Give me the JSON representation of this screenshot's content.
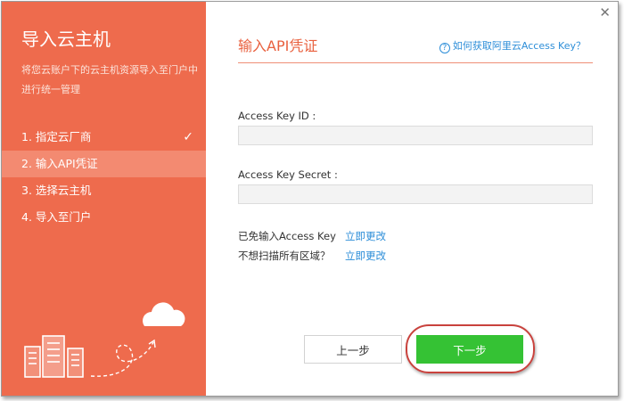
{
  "sidebar": {
    "title": "导入云主机",
    "description": "将您云账户下的云主机资源导入至门户中进行统一管理",
    "steps": [
      {
        "label": "1. 指定云厂商",
        "done": true
      },
      {
        "label": "2. 输入API凭证",
        "active": true
      },
      {
        "label": "3. 选择云主机"
      },
      {
        "label": "4. 导入至门户"
      }
    ]
  },
  "content": {
    "title": "输入API凭证",
    "help_icon": "?",
    "help_link": "如何获取阿里云Access Key？",
    "access_key_id_label": "Access Key ID :",
    "access_key_id_value": "",
    "access_key_secret_label": "Access Key Secret :",
    "access_key_secret_value": "",
    "option1_label": "已免输入Access Key",
    "option1_link": "立即更改",
    "option2_label": "不想扫描所有区域？",
    "option2_link": "立即更改",
    "prev_button": "上一步",
    "next_button": "下一步",
    "close_icon": "✕"
  },
  "colors": {
    "sidebar_bg": "#ee6b4d",
    "active_step_bg": "#f38a71",
    "accent": "#e9613f",
    "link": "#2d8ed8",
    "primary_button": "#35c234",
    "highlight": "#c9423d"
  }
}
